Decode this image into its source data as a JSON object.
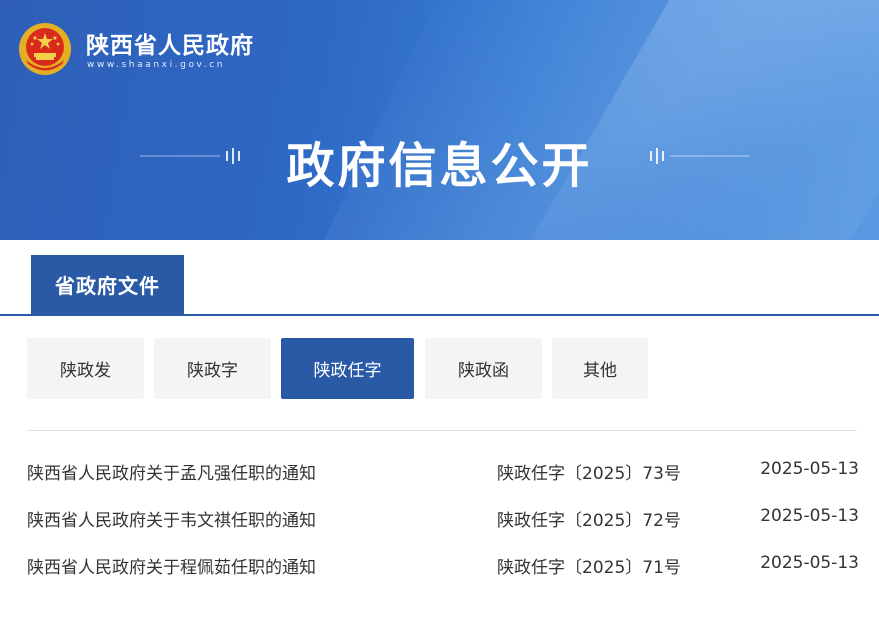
{
  "header": {
    "site_name": "陕西省人民政府",
    "site_url": "www.shaanxi.gov.cn",
    "hero_title": "政府信息公开"
  },
  "section_tab": {
    "label": "省政府文件"
  },
  "categories": [
    {
      "label": "陕政发",
      "active": false
    },
    {
      "label": "陕政字",
      "active": false
    },
    {
      "label": "陕政任字",
      "active": true
    },
    {
      "label": "陕政函",
      "active": false
    },
    {
      "label": "其他",
      "active": false
    }
  ],
  "documents": [
    {
      "title": "陕西省人民政府关于孟凡强任职的通知",
      "doc_number": "陕政任字〔2025〕73号",
      "date": "2025-05-13"
    },
    {
      "title": "陕西省人民政府关于韦文祺任职的通知",
      "doc_number": "陕政任字〔2025〕72号",
      "date": "2025-05-13"
    },
    {
      "title": "陕西省人民政府关于程佩茹任职的通知",
      "doc_number": "陕政任字〔2025〕71号",
      "date": "2025-05-13"
    }
  ],
  "colors": {
    "accent": "#2a5aa6",
    "banner": "#2f63bd",
    "tab_bg": "#f4f4f4"
  },
  "icons": {
    "logo": "national-emblem-icon"
  }
}
